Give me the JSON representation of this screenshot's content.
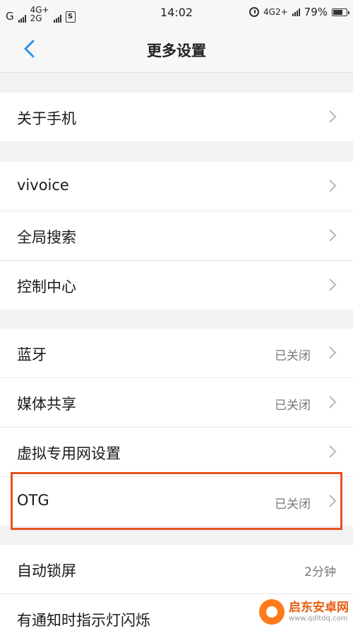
{
  "status_bar": {
    "carrier1": "G",
    "net_top": "4G+",
    "net_bottom": "2G",
    "sim_label": "S",
    "time": "14:02",
    "net_right": "4G2+",
    "battery": "79%",
    "battery_level": 0.79
  },
  "navbar": {
    "title": "更多设置",
    "back_icon": "chevron-left-icon"
  },
  "groups": [
    {
      "items": [
        {
          "label": "关于手机",
          "value": ""
        }
      ]
    },
    {
      "items": [
        {
          "label": "vivoice",
          "value": ""
        },
        {
          "label": "全局搜索",
          "value": ""
        },
        {
          "label": "控制中心",
          "value": ""
        }
      ]
    },
    {
      "items": [
        {
          "label": "蓝牙",
          "value": "已关闭"
        },
        {
          "label": "媒体共享",
          "value": "已关闭"
        },
        {
          "label": "虚拟专用网设置",
          "value": ""
        },
        {
          "label": "OTG",
          "value": "已关闭"
        }
      ]
    },
    {
      "items": [
        {
          "label": "自动锁屏",
          "value": "2分钟"
        },
        {
          "label": "有通知时指示灯闪烁",
          "value": ""
        }
      ]
    }
  ],
  "watermark": {
    "title": "启东安卓网",
    "url": "www.qdltdq.com"
  },
  "colors": {
    "accent": "#2f8fe8",
    "highlight": "#e8521f"
  }
}
